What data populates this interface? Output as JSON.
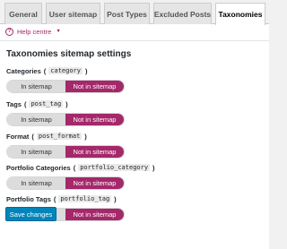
{
  "tabs": [
    "General",
    "User sitemap",
    "Post Types",
    "Excluded Posts",
    "Taxonomies"
  ],
  "help": {
    "label": "Help centre",
    "caret": "▼",
    "icon": "?"
  },
  "section_title": "Taxonomies sitemap settings",
  "fields": [
    {
      "name": "Categories",
      "code": "category"
    },
    {
      "name": "Tags",
      "code": "post_tag"
    },
    {
      "name": "Format",
      "code": "post_format"
    },
    {
      "name": "Portfolio Categories",
      "code": "portfolio_category"
    },
    {
      "name": "Portfolio Tags",
      "code": "portfolio_tag"
    }
  ],
  "toggle": {
    "in_label": "In sitemap",
    "out_label": "Not in sitemap",
    "selected": "Not in sitemap"
  },
  "paren_open": "(",
  "paren_close": ")",
  "save_label": "Save changes",
  "colors": {
    "accent": "#a4286a",
    "button": "#0085ba",
    "toggle_off": "#dcdcdc"
  }
}
